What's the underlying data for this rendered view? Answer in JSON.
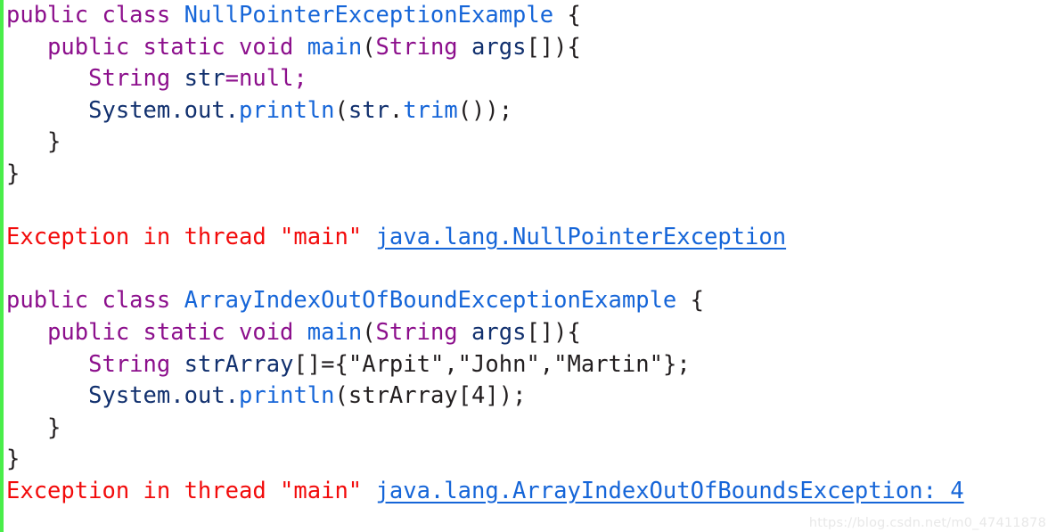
{
  "page": {
    "background_color": "#ffffff",
    "accent_bar_color": "#4aee4a"
  },
  "theme": {
    "keyword_color": "#8c0f8c",
    "type_color": "#1565d8",
    "identifier_color": "#11306e",
    "punctuation_color": "#231f20",
    "error_color": "#f20b0b",
    "link_color": "#1565d8",
    "watermark_color": "#e8e8e8"
  },
  "block1": {
    "line1": {
      "kw1": "public class ",
      "type1": "NullPointerExceptionExample",
      "punct1": " {"
    },
    "line2": {
      "indent": "   ",
      "kw1": "public static void ",
      "type1": "main",
      "punct1": "(",
      "kw2": "String",
      "punct2": " ",
      "ident1": "args",
      "punct3": "[]){"
    },
    "line3": {
      "indent": "      ",
      "kw1": "String",
      "punct1": " ",
      "ident1": "str",
      "kw2": "=null;"
    },
    "line4": {
      "indent": "      ",
      "ident1": "System",
      "punct1": ".",
      "ident2": "out",
      "punct2": ".",
      "type1": "println",
      "punct3": "(",
      "ident3": "str",
      "punct4": ".",
      "type2": "trim",
      "punct5": "());"
    },
    "line5": "   }",
    "line6": "}"
  },
  "error1": {
    "text": "Exception in thread \"main\" ",
    "link": "java.lang.NullPointerException"
  },
  "block2": {
    "line1": {
      "kw1": "public class ",
      "type1": "ArrayIndexOutOfBoundExceptionExample",
      "punct1": " {"
    },
    "line2": {
      "indent": "   ",
      "kw1": "public static void ",
      "type1": "main",
      "punct1": "(",
      "kw2": "String",
      "punct2": " ",
      "ident1": "args",
      "punct3": "[]){"
    },
    "line3": {
      "indent": "      ",
      "kw1": "String",
      "punct1": " ",
      "ident1": "strArray",
      "punct2": "[]={",
      "str1": "\"Arpit\",\"John\",\"Martin\"",
      "punct3": "};"
    },
    "line4": {
      "indent": "      ",
      "ident1": "System",
      "punct1": ".",
      "ident2": "out",
      "punct2": ".",
      "type1": "println",
      "punct3": "(",
      "ident3": "strArray",
      "punct4": "[4]);"
    },
    "line5": "   }",
    "line6": "}"
  },
  "error2": {
    "text": "Exception in thread \"main\" ",
    "link": "java.lang.ArrayIndexOutOfBoundsException: 4"
  },
  "watermark": {
    "text": "https://blog.csdn.net/m0_47411878"
  }
}
